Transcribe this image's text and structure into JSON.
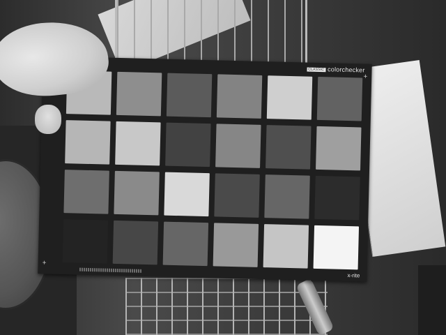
{
  "photo": {
    "subject": "",
    "tone": "grayscale"
  },
  "card": {
    "brand_tag": "CLASSIC",
    "brand_name": "colorchecker",
    "maker": "x-rite",
    "patches": [
      "#b9b9b9",
      "#8e8e8e",
      "#5b5b5b",
      "#838383",
      "#cfcfcf",
      "#626262",
      "#b6b6b6",
      "#c8c8c8",
      "#424242",
      "#868686",
      "#4f4f4f",
      "#9f9f9f",
      "#6e6e6e",
      "#8a8a8a",
      "#d9d9d9",
      "#4a4a4a",
      "#666666",
      "#2c2c2c",
      "#232323",
      "#474747",
      "#666666",
      "#999999",
      "#c5c5c5",
      "#f4f4f4"
    ]
  }
}
